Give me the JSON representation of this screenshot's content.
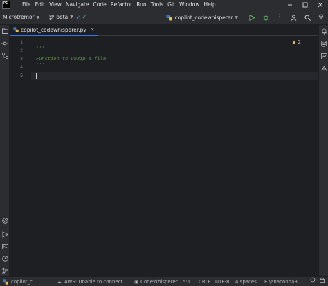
{
  "menu": {
    "logo_text": "PC",
    "items": [
      "File",
      "Edit",
      "View",
      "Navigate",
      "Code",
      "Refactor",
      "Run",
      "Tools",
      "Git",
      "Window",
      "Help"
    ]
  },
  "toolbar": {
    "project": "Microtremor",
    "branch": "beta",
    "run_config": "copilot_codewhisperer"
  },
  "tab": {
    "label": "copilot_codewhisperer.py"
  },
  "editor": {
    "line_numbers": [
      "1",
      "2",
      "3",
      "4",
      "5"
    ],
    "lines": [
      "",
      "'''",
      "Function to unzip a file",
      "'''",
      ""
    ],
    "problems_count": "2"
  },
  "statusbar": {
    "project_short": "copilot_c",
    "aws": "AWS: Unable to connect",
    "codewhisperer": "CodeWhisperer",
    "position": "5:1",
    "line_sep": "CRLF",
    "encoding": "UTF-8",
    "indent": "4 spaces",
    "interpreter": "E:\\anaconda3"
  },
  "colors": {
    "accent": "#3574f0",
    "comment": "#5f8c4a",
    "run": "#5fb865",
    "warning": "#e9b54a"
  },
  "icons": {
    "left_strip": [
      "folder-icon",
      "commit-icon",
      "structure-icon",
      "python-packages-icon",
      "services-icon",
      "terminal-icon",
      "problems-icon",
      "git-icon"
    ],
    "right_strip": [
      "notifications-icon",
      "database-icon",
      "sciview-icon",
      "codewhisperer-icon"
    ]
  }
}
